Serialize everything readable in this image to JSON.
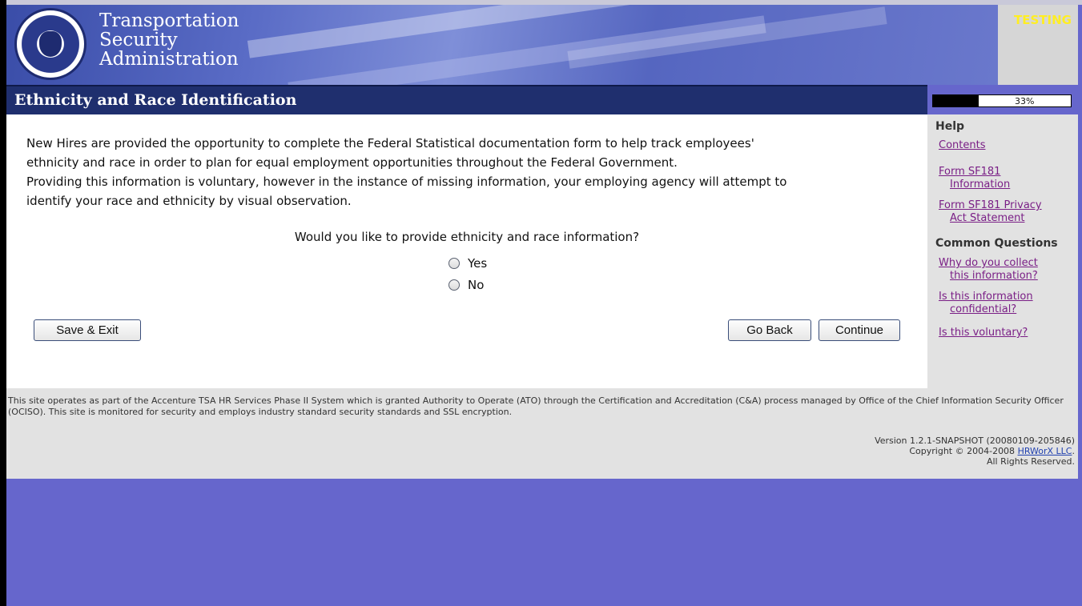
{
  "header": {
    "agency_line1": "Transportation",
    "agency_line2": "Security",
    "agency_line3": "Administration",
    "env_badge": "TESTING"
  },
  "page": {
    "title": "Ethnicity and Race Identification",
    "progress_percent": 33,
    "progress_label": "33%"
  },
  "main": {
    "intro_line1": "New Hires are provided the opportunity to complete the Federal Statistical documentation form to help track employees'",
    "intro_line2": "ethnicity and race in order to plan for equal employment opportunities throughout the Federal Government.",
    "intro_line3": "Providing this information is voluntary, however in the instance of missing information, your employing agency will attempt to",
    "intro_line4": "identify your race and ethnicity by visual observation.",
    "question": "Would you like to provide ethnicity and race information?",
    "options": [
      "Yes",
      "No"
    ],
    "buttons": {
      "save_exit": "Save & Exit",
      "go_back": "Go Back",
      "continue": "Continue"
    }
  },
  "sidebar": {
    "help_heading": "Help",
    "contents": "Contents",
    "sf181_info_1": "Form SF181",
    "sf181_info_2": "Information",
    "sf181_privacy_1": "Form SF181 Privacy",
    "sf181_privacy_2": "Act Statement",
    "common_heading": "Common Questions",
    "q1_1": "Why do you collect",
    "q1_2": "this information?",
    "q2_1": "Is this information",
    "q2_2": "confidential?",
    "q3": "Is this voluntary?"
  },
  "footer": {
    "notice": "This site operates as part of the Accenture TSA HR Services Phase II System which is granted Authority to Operate (ATO) through the Certification and Accreditation (C&A) process managed by Office of the Chief Information Security Officer (OCISO). This site is monitored for security and employs industry standard security standards and SSL encryption.",
    "version": "Version 1.2.1-SNAPSHOT (20080109-205846)",
    "copyright_prefix": "Copyright © 2004-2008 ",
    "company_link": "HRWorX LLC",
    "copyright_suffix": ".",
    "rights": "All Rights Reserved."
  }
}
